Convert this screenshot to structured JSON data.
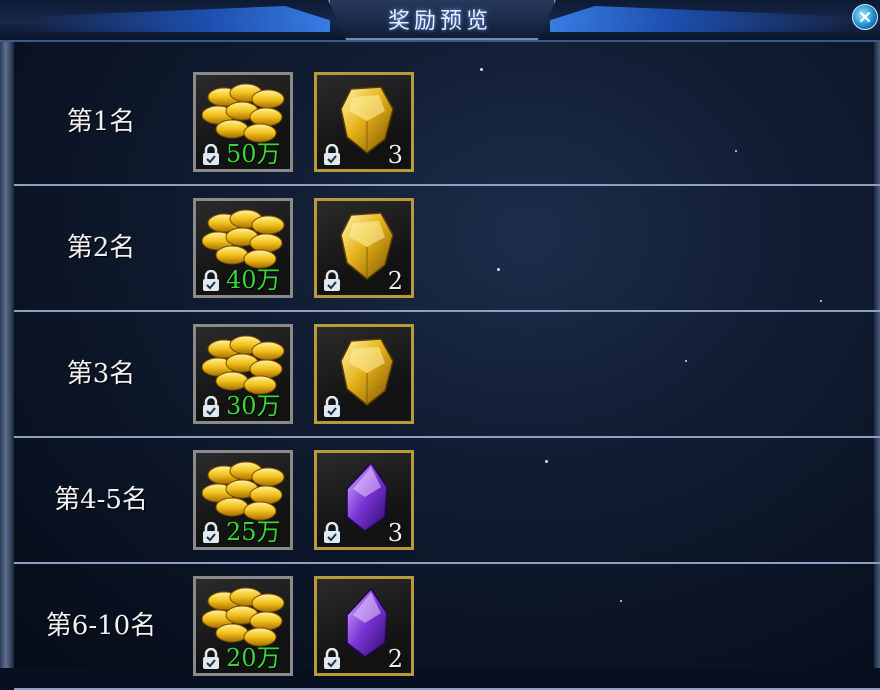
{
  "dialog": {
    "title": "奖励预览"
  },
  "rewards": [
    {
      "rank": "第1名",
      "coins": "50万",
      "gem_type": "gold-gem",
      "gem_qty": "3"
    },
    {
      "rank": "第2名",
      "coins": "40万",
      "gem_type": "gold-gem",
      "gem_qty": "2"
    },
    {
      "rank": "第3名",
      "coins": "30万",
      "gem_type": "gold-gem",
      "gem_qty": ""
    },
    {
      "rank": "第4-5名",
      "coins": "25万",
      "gem_type": "purple-gem",
      "gem_qty": "3"
    },
    {
      "rank": "第6-10名",
      "coins": "20万",
      "gem_type": "purple-gem",
      "gem_qty": "2"
    }
  ],
  "colors": {
    "amount_green": "#39d639",
    "slot_gold_border": "#b89a3a",
    "title_glow": "#6fa0ff"
  },
  "icons": {
    "coin": "gold-coins-icon",
    "lock": "bound-lock-icon",
    "close": "close-icon"
  }
}
